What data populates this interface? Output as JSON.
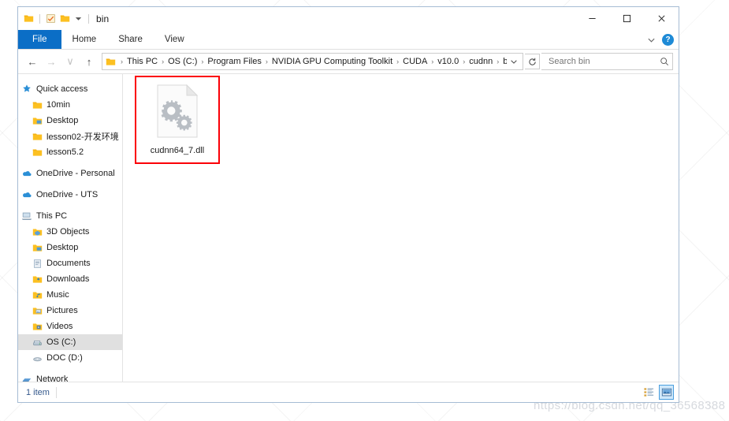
{
  "window": {
    "title": "bin",
    "quick_access_toolbar": [
      {
        "name": "folder-icon",
        "label": "Folder"
      },
      {
        "name": "properties-icon",
        "label": "Properties"
      },
      {
        "name": "new-folder-icon",
        "label": "New folder"
      },
      {
        "name": "customize-dropdown-icon",
        "label": "Customize Quick Access Toolbar"
      }
    ],
    "controls": {
      "minimize": "–",
      "maximize": "☐",
      "close": "✕"
    }
  },
  "ribbon": {
    "tabs": [
      {
        "label": "File",
        "active": true
      },
      {
        "label": "Home",
        "active": false
      },
      {
        "label": "Share",
        "active": false
      },
      {
        "label": "View",
        "active": false
      }
    ],
    "expand_icon": "∨",
    "help_label": "?"
  },
  "address": {
    "back_icon": "←",
    "forward_icon": "→",
    "recent_icon": "∨",
    "up_icon": "↑",
    "crumbs": [
      "This PC",
      "OS (C:)",
      "Program Files",
      "NVIDIA GPU Computing Toolkit",
      "CUDA",
      "v10.0",
      "cudnn",
      "bin"
    ],
    "separator": "›",
    "dropdown_icon": "∨",
    "refresh_icon": "↻"
  },
  "search": {
    "placeholder": "Search bin",
    "value": "",
    "icon": "search-icon"
  },
  "sidebar": {
    "groups": [
      {
        "header": {
          "label": "Quick access",
          "icon": "pin-star-icon"
        },
        "items": [
          {
            "label": "10min",
            "icon": "folder-icon"
          },
          {
            "label": "Desktop",
            "icon": "desktop-folder-icon"
          },
          {
            "label": "lesson02-开发环境",
            "icon": "folder-icon"
          },
          {
            "label": "lesson5.2",
            "icon": "folder-icon"
          }
        ]
      },
      {
        "header": {
          "label": "OneDrive - Personal",
          "icon": "onedrive-icon"
        },
        "items": []
      },
      {
        "header": {
          "label": "OneDrive - UTS",
          "icon": "onedrive-icon"
        },
        "items": []
      },
      {
        "header": {
          "label": "This PC",
          "icon": "this-pc-icon"
        },
        "items": [
          {
            "label": "3D Objects",
            "icon": "3d-objects-icon"
          },
          {
            "label": "Desktop",
            "icon": "desktop-folder-icon"
          },
          {
            "label": "Documents",
            "icon": "documents-icon"
          },
          {
            "label": "Downloads",
            "icon": "downloads-icon"
          },
          {
            "label": "Music",
            "icon": "music-icon"
          },
          {
            "label": "Pictures",
            "icon": "pictures-icon"
          },
          {
            "label": "Videos",
            "icon": "videos-icon"
          },
          {
            "label": "OS (C:)",
            "icon": "hard-drive-icon",
            "selected": true
          },
          {
            "label": "DOC (D:)",
            "icon": "disc-drive-icon"
          }
        ]
      },
      {
        "header": {
          "label": "Network",
          "icon": "network-icon"
        },
        "items": []
      }
    ]
  },
  "content": {
    "files": [
      {
        "name": "cudnn64_7.dll",
        "icon": "dll-gears-file-icon",
        "highlighted": true
      }
    ],
    "annotation_color": "#fb0007"
  },
  "statusbar": {
    "item_count": "1 item",
    "views": [
      {
        "name": "details-view-button",
        "active": false
      },
      {
        "name": "large-icons-view-button",
        "active": true
      }
    ]
  },
  "watermark": {
    "text": "https://blog.csdn.net/qq_36568388"
  }
}
